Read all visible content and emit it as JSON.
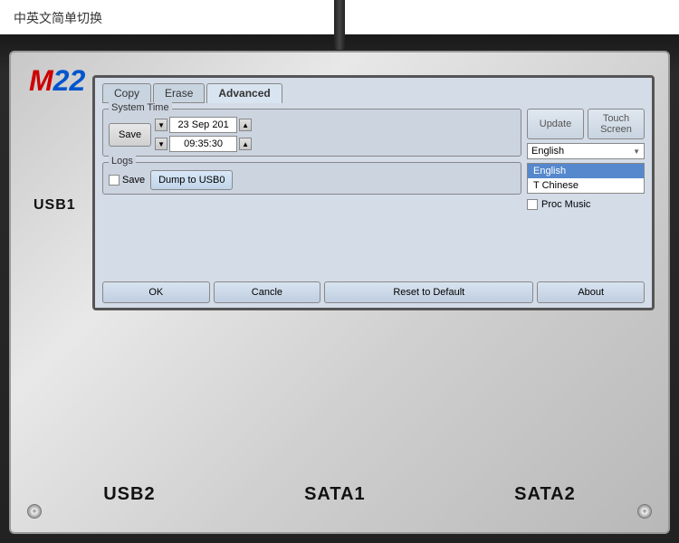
{
  "top": {
    "chinese_text": "中英文简单切换"
  },
  "logo": {
    "m": "M",
    "numbers": "22"
  },
  "tabs": {
    "items": [
      {
        "label": "Copy",
        "active": false
      },
      {
        "label": "Erase",
        "active": false
      },
      {
        "label": "Advanced",
        "active": true
      }
    ]
  },
  "system_time": {
    "label": "System Time",
    "save_btn": "Save",
    "date_value": "23 Sep 201",
    "time_value": "09:35:30"
  },
  "logs": {
    "label": "Logs",
    "save_label": "Save",
    "dump_btn": "Dump to USB0"
  },
  "right_panel": {
    "update_btn": "Update",
    "touch_screen_btn": "Touch\nScreen",
    "language_selected": "English",
    "dropdown_items": [
      {
        "label": "English",
        "selected": true
      },
      {
        "label": "T Chinese",
        "selected": false
      }
    ],
    "proc_music_label": "Proc Music"
  },
  "bottom_buttons": {
    "ok": "OK",
    "cancel": "Cancle",
    "reset": "Reset to Default",
    "about": "About"
  },
  "device_labels": {
    "usb1": "USB1",
    "usb2": "USB2",
    "sata1": "SATA1",
    "sata2": "SATA2"
  }
}
